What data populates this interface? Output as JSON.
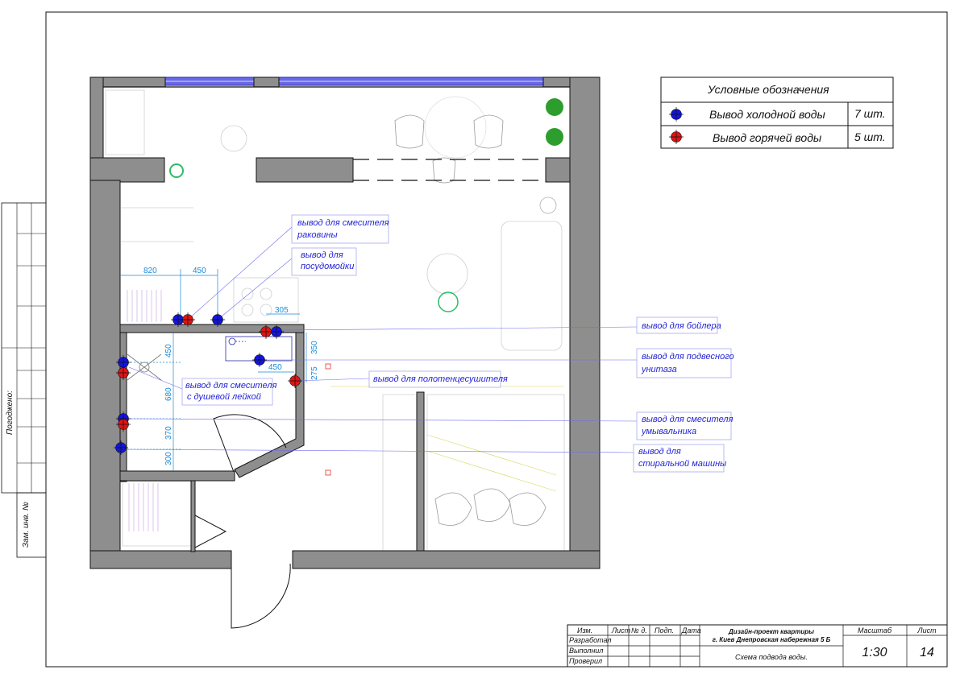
{
  "legend": {
    "title": "Условные обозначения",
    "rows": [
      {
        "label": "Вывод холодной воды",
        "count": "7 шт.",
        "color": "#1414e0"
      },
      {
        "label": "Вывод горячей воды",
        "count": "5 шт.",
        "color": "#e01414"
      }
    ]
  },
  "callouts": {
    "sink_l1": "вывод для смесителя",
    "sink_l2": "раковины",
    "dish_l1": "вывод для",
    "dish_l2": "посудомойки",
    "boiler": "вывод для бойлера",
    "toilet_l1": "вывод для подвесного",
    "toilet_l2": "унитаза",
    "towel": "вывод для полотенцесушителя",
    "shower_l1": "вывод для смесителя",
    "shower_l2": "с душевой лейкой",
    "basin_l1": "вывод для смесителя",
    "basin_l2": "умывальника",
    "washer_l1": "вывод для",
    "washer_l2": "стиральной машины"
  },
  "dimensions": {
    "d820": "820",
    "d450a": "450",
    "d305": "305",
    "d450b": "450",
    "d350": "350",
    "d275": "275",
    "d450v": "450",
    "d680": "680",
    "d370": "370",
    "d300": "300"
  },
  "side_stamp": {
    "agreed": "Погоджено:",
    "inv": "Зам. инв. №"
  },
  "title_block": {
    "h_izm": "Изм.",
    "h_list": "Лист",
    "h_ndok": "№ д.",
    "h_podp": "Подп.",
    "h_data": "Дата",
    "r_razrab": "Разработал",
    "r_vypolnil": "Выполнил",
    "r_proveril": "Проверил",
    "project_l1": "Дизайн-проект квартиры",
    "project_l2": "г. Киев Днепровская набережная 5 Б",
    "sheet_name": "Схема подвода воды.",
    "scale_label": "Масштаб",
    "scale_value": "1:30",
    "sheet_label": "Лист",
    "sheet_value": "14"
  }
}
